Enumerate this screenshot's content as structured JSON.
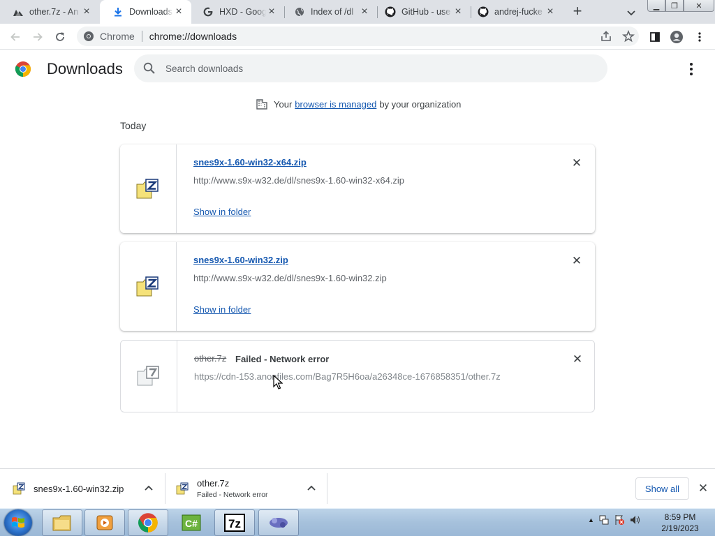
{
  "tabs": [
    {
      "title": "other.7z - An",
      "icon": "anonfiles-icon",
      "active": false
    },
    {
      "title": "Downloads",
      "icon": "download-icon",
      "active": true
    },
    {
      "title": "HXD - Googl",
      "icon": "google-icon",
      "active": false
    },
    {
      "title": "Index of /dl",
      "icon": "globe-icon",
      "active": false
    },
    {
      "title": "GitHub - use",
      "icon": "github-icon",
      "active": false
    },
    {
      "title": "andrej-fucke",
      "icon": "github-icon",
      "active": false
    }
  ],
  "toolbar": {
    "chip_label": "Chrome",
    "url": "chrome://downloads"
  },
  "page": {
    "title": "Downloads",
    "search_placeholder": "Search downloads",
    "managed_prefix": "Your",
    "managed_link": "browser is managed",
    "managed_suffix": "by your organization",
    "section_label": "Today"
  },
  "downloads": [
    {
      "name": "snes9x-1.60-win32-x64.zip",
      "url": "http://www.s9x-w32.de/dl/snes9x-1.60-win32-x64.zip",
      "action": "Show in folder",
      "status": ""
    },
    {
      "name": "snes9x-1.60-win32.zip",
      "url": "http://www.s9x-w32.de/dl/snes9x-1.60-win32.zip",
      "action": "Show in folder",
      "status": ""
    },
    {
      "name": "other.7z",
      "url": "https://cdn-153.anonfiles.com/Bag7R5H6oa/a26348ce-1676858351/other.7z",
      "action": "",
      "status": "Failed - Network error"
    }
  ],
  "shelf": {
    "items": [
      {
        "name": "snes9x-1.60-win32.zip",
        "sub": ""
      },
      {
        "name": "other.7z",
        "sub": "Failed - Network error"
      }
    ],
    "show_all": "Show all"
  },
  "taskbar": {
    "apps": [
      "start-orb",
      "file-explorer",
      "media-player",
      "chrome",
      "csharp-ide",
      "7zip",
      "other-app"
    ],
    "time": "8:59 PM",
    "date": "2/19/2023"
  },
  "colors": {
    "link": "#1558b0",
    "tabstrip": "#dee1e6",
    "search_bg": "#f1f3f4",
    "taskbar": "#a6c1dc"
  }
}
